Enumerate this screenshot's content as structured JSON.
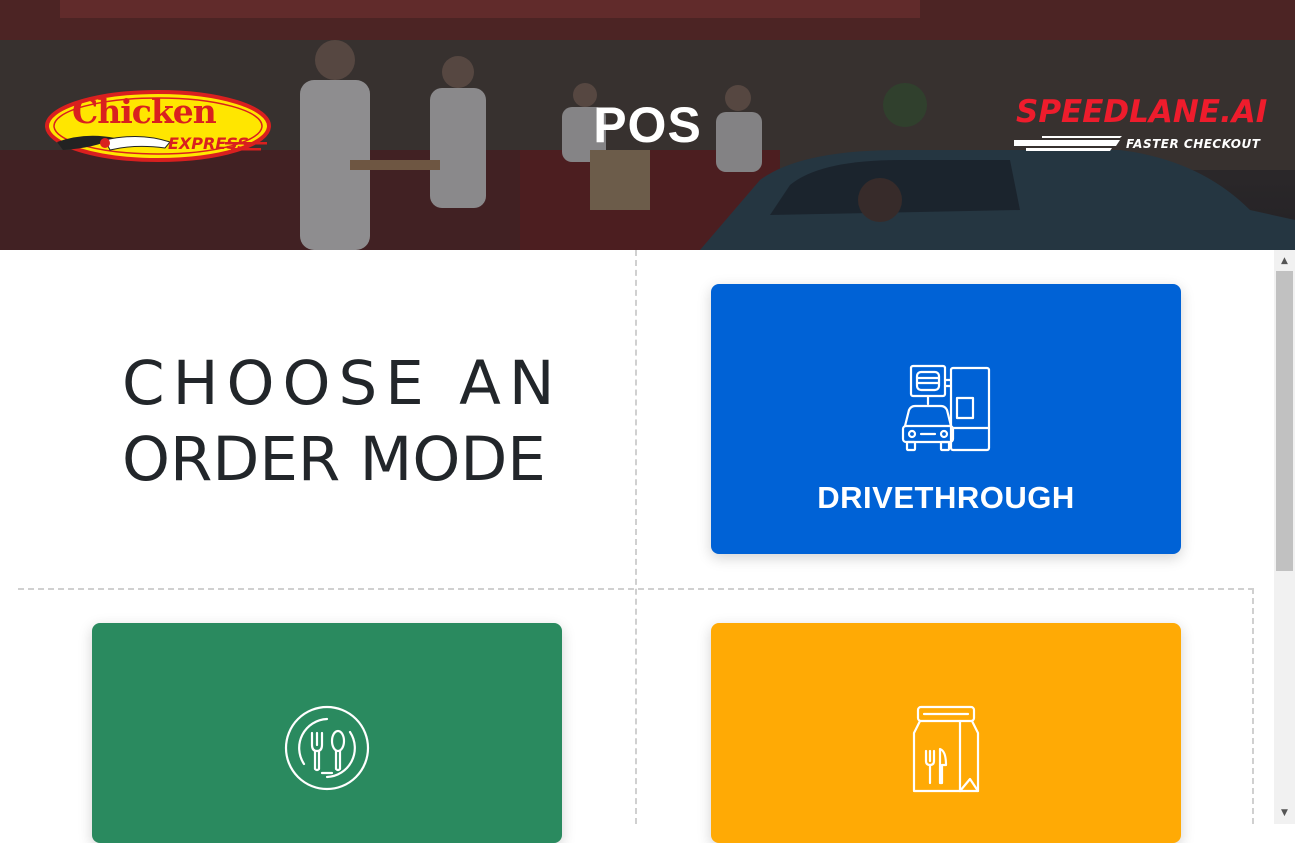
{
  "header": {
    "title": "POS",
    "left_logo": {
      "line1": "Chicken",
      "line2": "EXPRESS"
    },
    "right_logo": {
      "name": "SPEEDLANE.AI",
      "tagline": "FASTER CHECKOUT"
    }
  },
  "main": {
    "heading_line1": "CHOOSE AN",
    "heading_line2": "ORDER MODE",
    "cards": [
      {
        "label": "DRIVETHROUGH",
        "icon": "drive-through-icon",
        "color": "#0062d6"
      },
      {
        "label": "",
        "icon": "dine-in-plate-icon",
        "color": "#2a8a5f"
      },
      {
        "label": "",
        "icon": "takeout-bag-icon",
        "color": "#ffaa05"
      }
    ]
  },
  "colors": {
    "drivethrough": "#0062d6",
    "dine_in": "#2a8a5f",
    "takeout": "#ffaa05",
    "heading": "#22262a"
  }
}
